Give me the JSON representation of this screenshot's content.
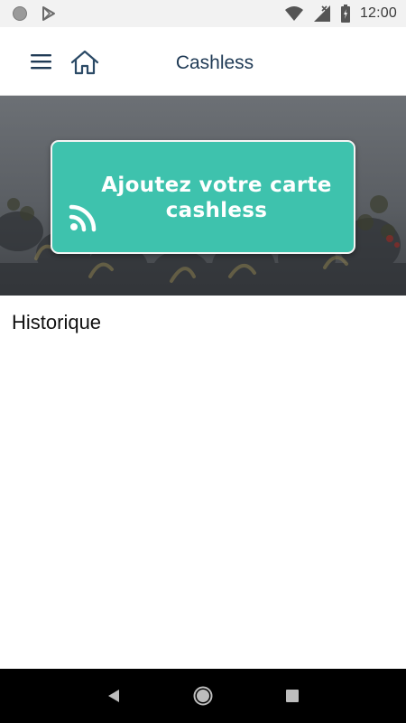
{
  "status_bar": {
    "time": "12:00",
    "icons": [
      "circle-icon",
      "play-store-icon",
      "wifi-icon",
      "signal-icon",
      "battery-icon"
    ]
  },
  "app_bar": {
    "title": "Cashless",
    "icons": [
      "menu-icon",
      "home-icon"
    ],
    "title_color": "#1f3a55"
  },
  "banner": {
    "card_label": "Ajoutez votre carte cashless",
    "card_color": "#3ec2ad",
    "icon": "nfc-icon"
  },
  "history": {
    "title": "Historique"
  },
  "nav_bar": {
    "icons": [
      "back-icon",
      "home-circle-icon",
      "recents-icon"
    ]
  }
}
